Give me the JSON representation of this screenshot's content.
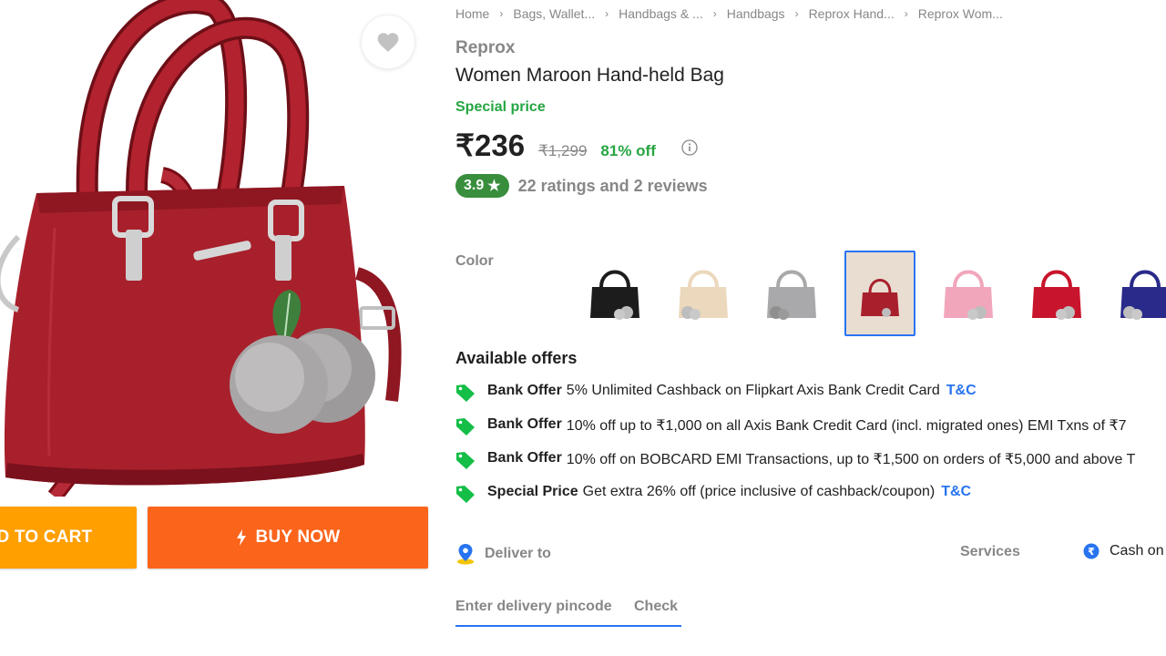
{
  "breadcrumb": [
    {
      "label": "Home"
    },
    {
      "label": "Bags, Wallet..."
    },
    {
      "label": "Handbags & ..."
    },
    {
      "label": "Handbags"
    },
    {
      "label": "Reprox Hand..."
    },
    {
      "label": "Reprox Wom..."
    }
  ],
  "product": {
    "brand": "Reprox",
    "title": "Women Maroon Hand-held Bag",
    "special_label": "Special price",
    "price": "₹236",
    "mrp": "₹1,299",
    "discount": "81% off",
    "rating": "3.9",
    "rating_star": "★",
    "rating_count": "22 ratings and 2 reviews",
    "main_bag_color": "#a8202c"
  },
  "actions": {
    "add_to_cart": "ADD TO CART",
    "buy_now": "BUY NOW",
    "cart_color": "#ff9f00",
    "buy_color": "#fb641b"
  },
  "color_section": {
    "label": "Color",
    "swatches": [
      {
        "color": "#1c1c1c",
        "selected": false
      },
      {
        "color": "#ecd8bc",
        "selected": false
      },
      {
        "color": "#a9a9ab",
        "selected": false
      },
      {
        "color": "#a8202c",
        "selected": true
      },
      {
        "color": "#f1a6bc",
        "selected": false
      },
      {
        "color": "#c8142c",
        "selected": false
      },
      {
        "color": "#2a2a8a",
        "selected": false
      }
    ]
  },
  "offers": {
    "heading": "Available offers",
    "items": [
      {
        "type": "Bank Offer",
        "text": "5% Unlimited Cashback on Flipkart Axis Bank Credit Card",
        "tnc": "T&C"
      },
      {
        "type": "Bank Offer",
        "text": "10% off up to ₹1,000 on all Axis Bank Credit Card (incl. migrated ones) EMI Txns of ₹7",
        "tnc": ""
      },
      {
        "type": "Bank Offer",
        "text": "10% off on BOBCARD EMI Transactions, up to ₹1,500 on orders of ₹5,000 and above T",
        "tnc": ""
      },
      {
        "type": "Special Price",
        "text": "Get extra 26% off (price inclusive of cashback/coupon)",
        "tnc": "T&C"
      }
    ]
  },
  "delivery": {
    "label": "Deliver to",
    "pincode_placeholder": "Enter delivery pincode",
    "check": "Check",
    "services_label": "Services",
    "cod_text": "Cash on"
  },
  "colors": {
    "accent": "#2874f0",
    "green": "#26a541",
    "rating_badge": "#388e3c",
    "muted_text": "#878787"
  }
}
